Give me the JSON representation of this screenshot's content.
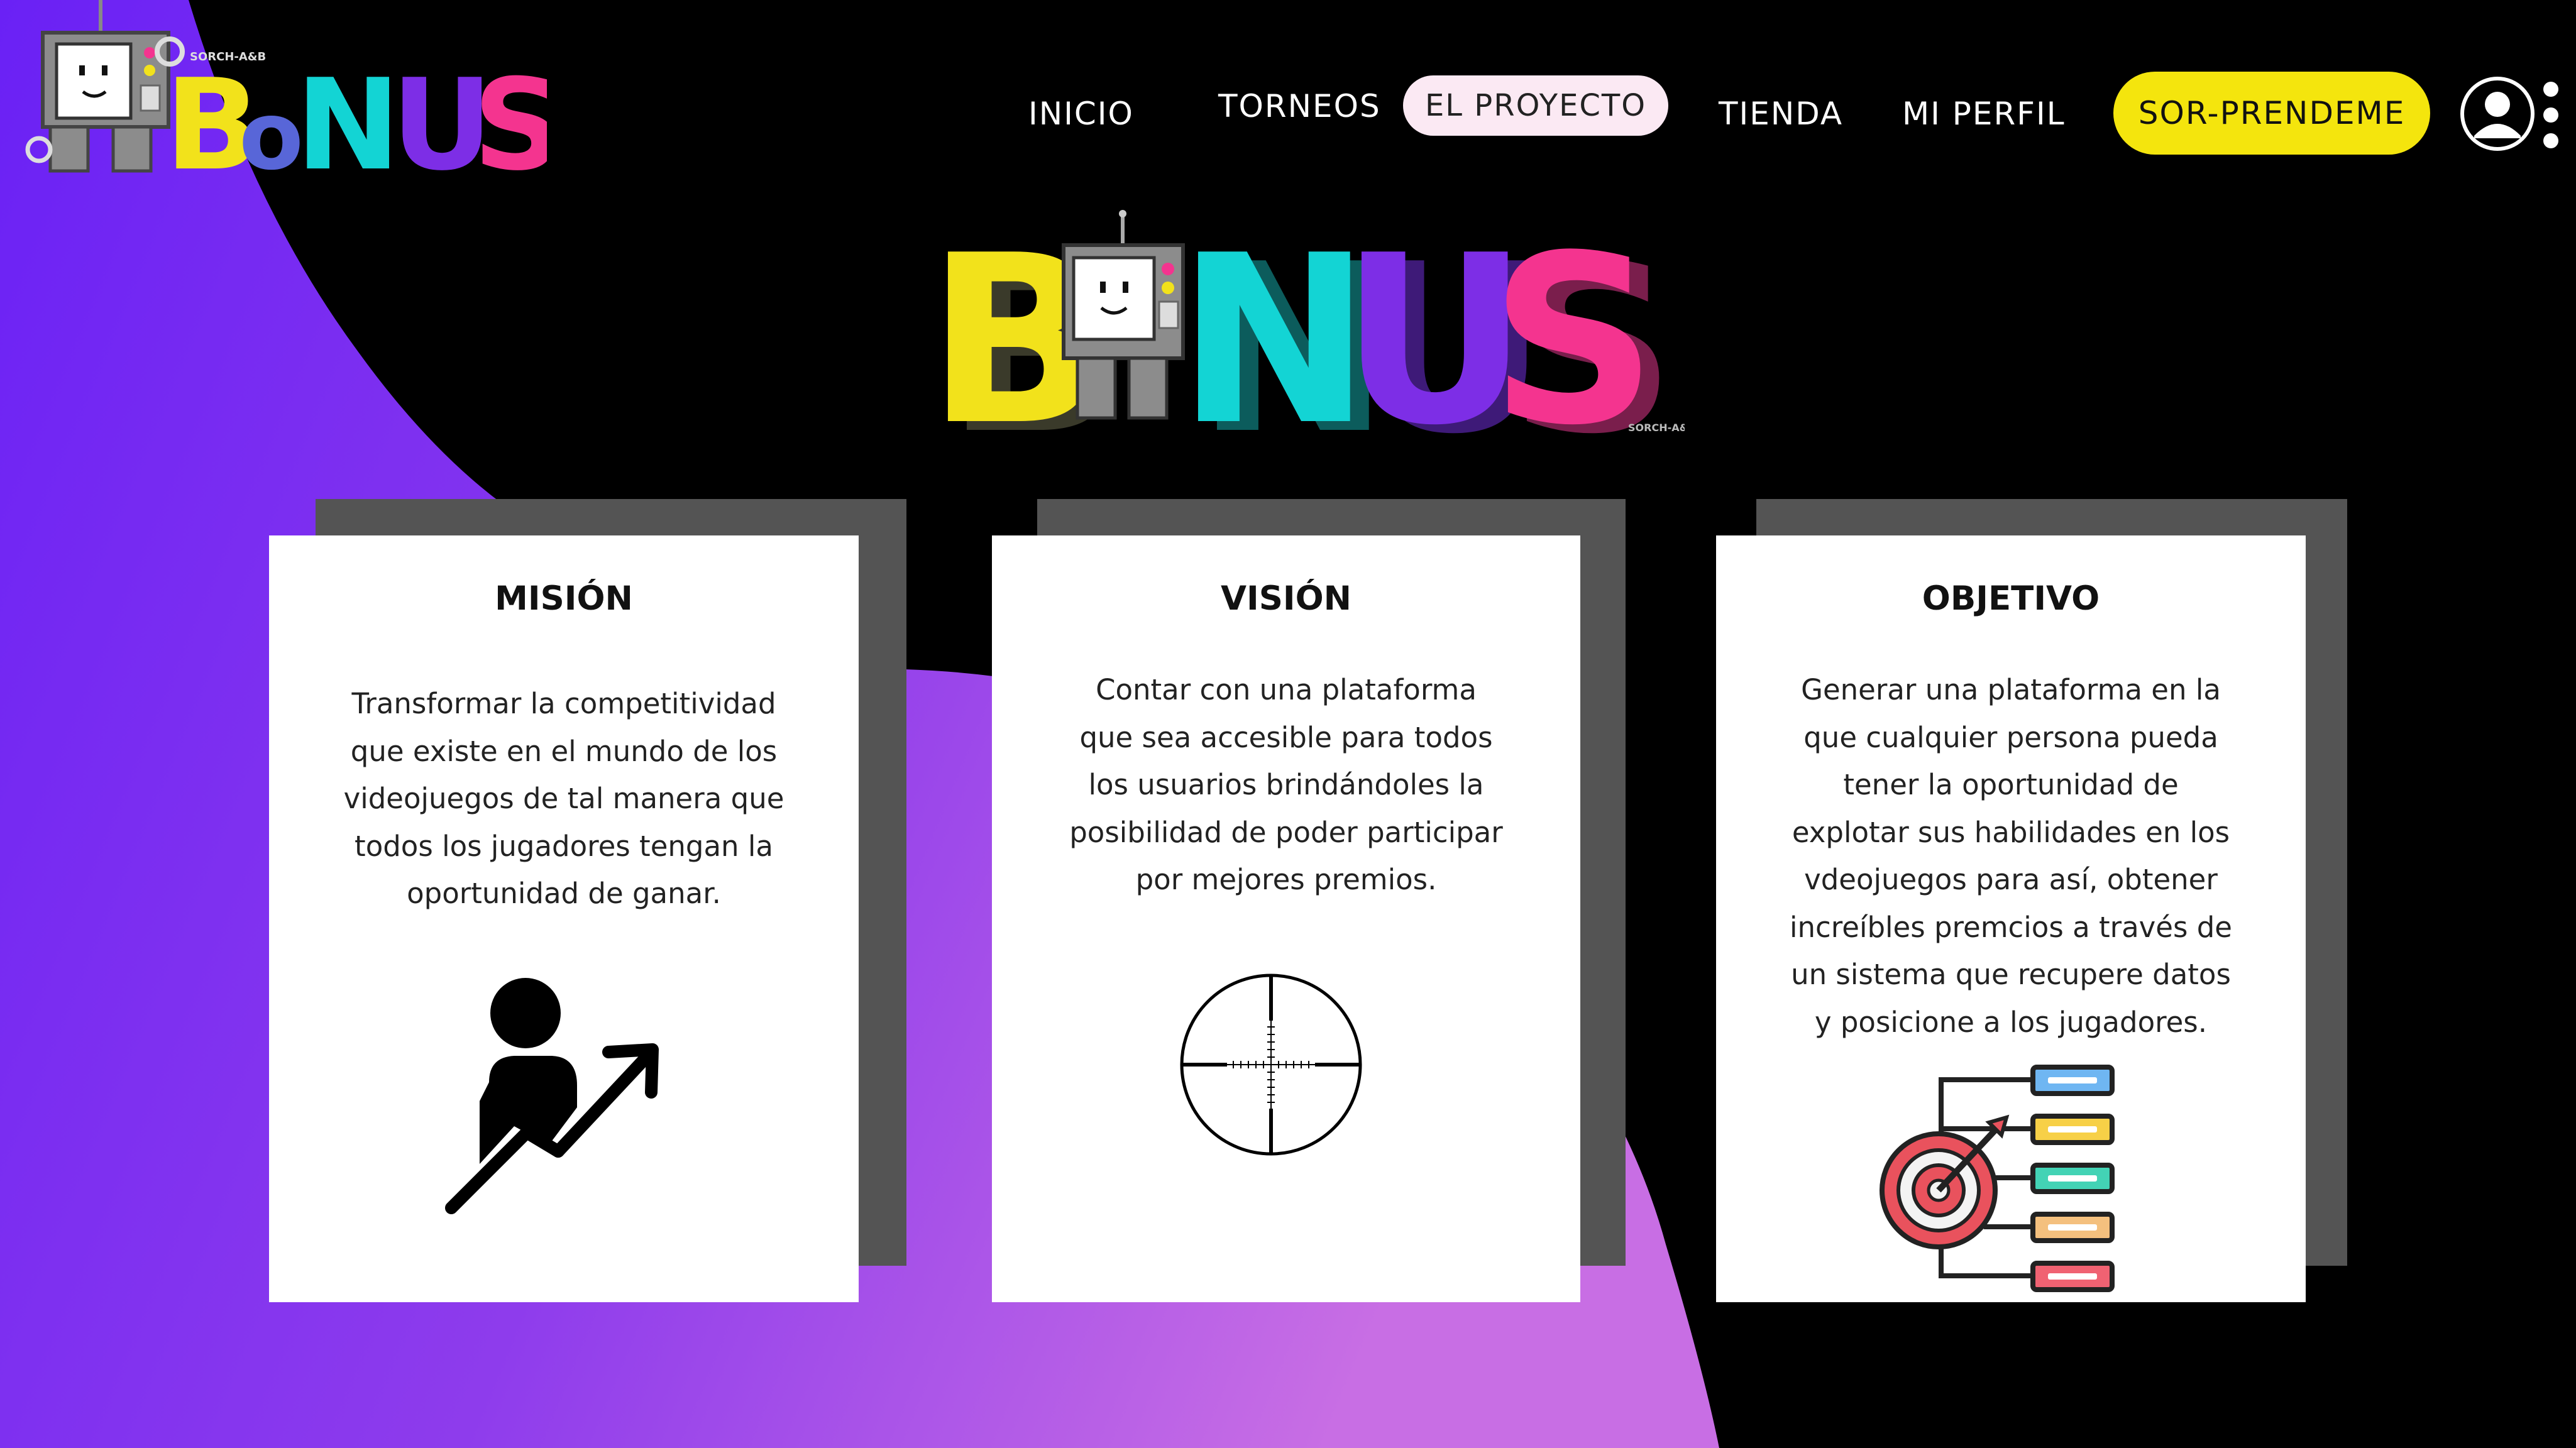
{
  "brand": {
    "logo_letters": [
      "B",
      "o",
      "N",
      "U",
      "S"
    ],
    "robot_caption": "SORCH-A&B",
    "colors": {
      "yellow": "#f2e21b",
      "blue": "#5866d8",
      "teal": "#13d4d4",
      "purple": "#7d2ee6",
      "pink": "#f4348f"
    }
  },
  "nav": {
    "items": [
      {
        "label": "INICIO"
      },
      {
        "label": "TORNEOS"
      },
      {
        "label": "EL PROYECTO",
        "active": true
      },
      {
        "label": "TIENDA"
      },
      {
        "label": "MI PERFIL"
      }
    ],
    "cta_label": "SOR-PRENDEME",
    "profile_icon": "user-circle-icon",
    "menu_icon": "kebab-menu-icon"
  },
  "hero_logo": {
    "letters": [
      "B",
      "N",
      "U",
      "S"
    ],
    "caption": "SORCH-A&B"
  },
  "cards": [
    {
      "title": "MISIÓN",
      "lines": [
        "Transformar la competitividad",
        "que existe en el mundo de los",
        "videojuegos de tal manera que",
        "todos los jugadores tengan la",
        "oportunidad de ganar."
      ],
      "icon": "person-growth-icon"
    },
    {
      "title": "VISIÓN",
      "lines": [
        "Contar con una plataforma",
        "que sea accesible para todos",
        "los usuarios brindándoles la",
        "posibilidad de poder participar",
        "por mejores premios."
      ],
      "icon": "crosshair-icon"
    },
    {
      "title": "OBJETIVO",
      "lines": [
        "Generar una plataforma en la",
        "que cualquier persona pueda",
        "tener la oportunidad de",
        "explotar sus habilidades en los",
        "vdeojuegos para así, obtener",
        "increíbles premcios a través de",
        "un sistema que recupere datos",
        "y posicione a los jugadores."
      ],
      "icon": "target-goals-icon"
    }
  ],
  "theme": {
    "background": "#000000",
    "gradient_start": "#6a21f5",
    "gradient_end": "#c76be6",
    "card_background": "#ffffff",
    "card_shadow": "#545454",
    "cta_background": "#f4e50d",
    "active_nav_background": "#fbe9f3"
  }
}
